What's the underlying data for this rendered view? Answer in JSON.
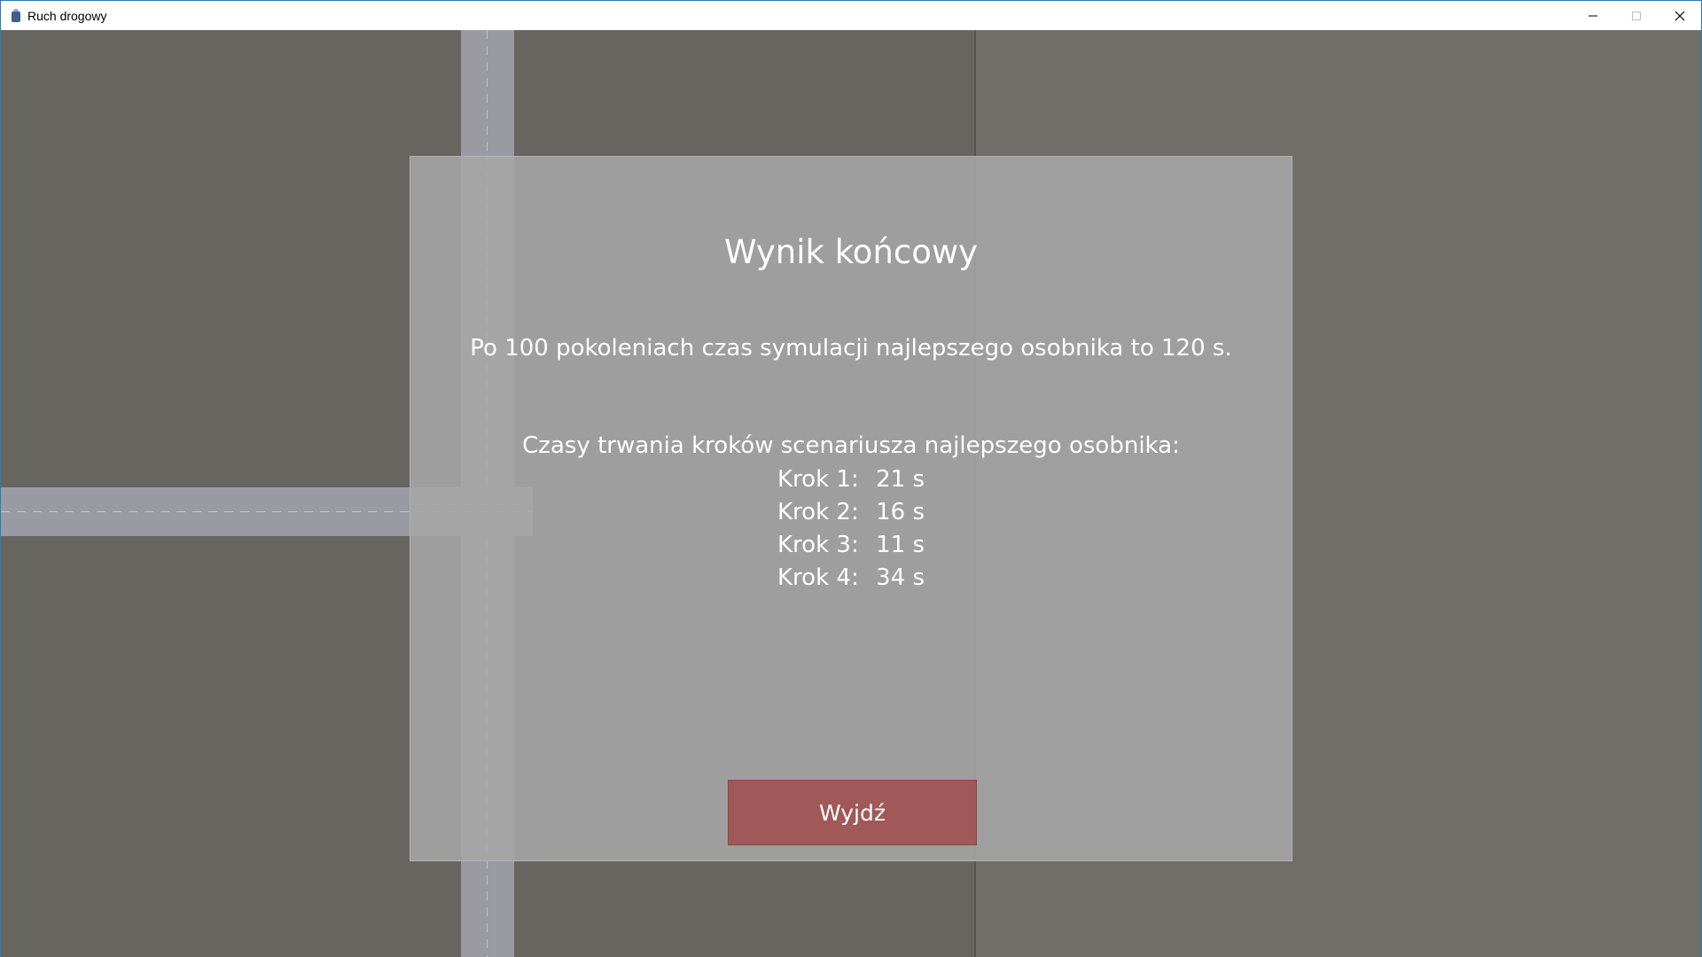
{
  "window": {
    "title": "Ruch drogowy",
    "icon": "app-icon",
    "controls": {
      "minimize_icon": "minimize-icon",
      "maximize_icon": "maximize-icon",
      "close_icon": "close-icon"
    }
  },
  "dialog": {
    "title": "Wynik końcowy",
    "summary": "Po 100 pokoleniach czas symulacji najlepszego osobnika to 120 s.",
    "steps_heading": "Czasy trwania kroków scenariusza najlepszego osobnika:",
    "steps": [
      {
        "label": "Krok 1:",
        "value": "21 s"
      },
      {
        "label": "Krok 2:",
        "value": "16 s"
      },
      {
        "label": "Krok 3:",
        "value": "11 s"
      },
      {
        "label": "Krok 4:",
        "value": "34 s"
      }
    ],
    "exit_label": "Wyjdź"
  },
  "colors": {
    "exit_button": "#a05858",
    "dialog_overlay": "#a6a6a6",
    "road": "#9a9aa2",
    "background": "#666560",
    "window_border": "#2a7ab8"
  }
}
